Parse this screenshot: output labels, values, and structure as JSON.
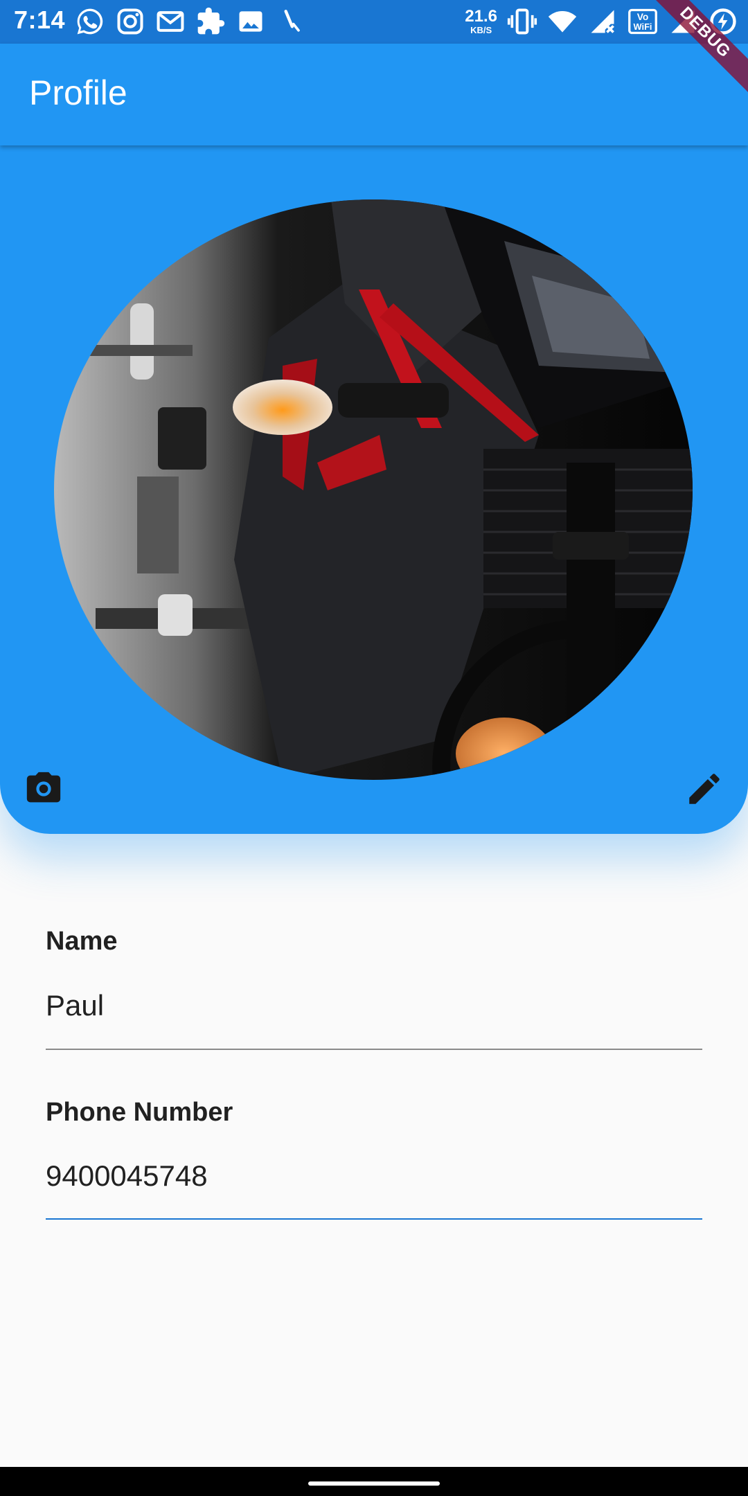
{
  "status_bar": {
    "time": "7:14",
    "net_speed": "21.6",
    "net_unit": "KB/S",
    "left_icons": [
      "whatsapp-icon",
      "instagram-icon",
      "gmail-icon",
      "puzzle-icon",
      "image-icon",
      "feather-icon"
    ],
    "right_icons": [
      "vibrate-icon",
      "wifi-icon",
      "signal-x-icon",
      "vowifi-icon",
      "signal-icon",
      "data-saver-icon"
    ]
  },
  "debug_banner": "DEBUG",
  "app_bar": {
    "title": "Profile"
  },
  "header": {
    "camera_icon": "camera-icon",
    "edit_icon": "edit-pencil-icon"
  },
  "form": {
    "name": {
      "label": "Name",
      "value": "Paul"
    },
    "phone": {
      "label": "Phone Number",
      "value": "9400045748"
    }
  },
  "colors": {
    "primary": "#2196F3",
    "status_bar": "#1976D2",
    "background": "#FAFAFA",
    "focused_underline": "#1976D2",
    "icon_dark": "#1A1A1A"
  }
}
